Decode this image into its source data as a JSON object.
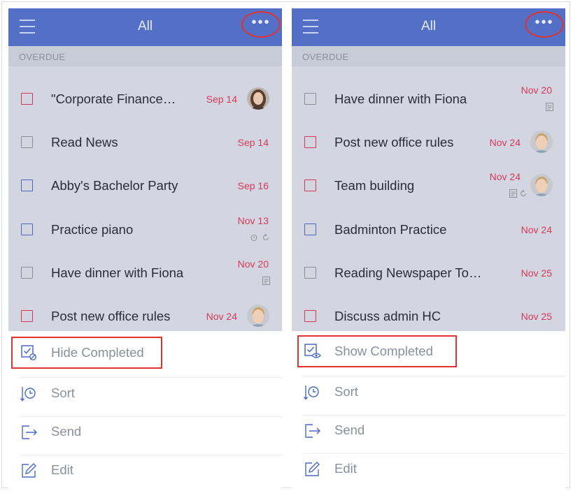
{
  "colors": {
    "header_bg": "#5470c6",
    "list_bg": "#d3d6e1",
    "date_red": "#d6385a",
    "checkbox_red": "#d6385a",
    "checkbox_blue": "#4a69c8",
    "checkbox_gray": "#8e8e93",
    "highlight_red": "#e0322f",
    "menu_text": "#8a8f9c"
  },
  "left": {
    "header": {
      "title": "All",
      "menu_icon": "hamburger-icon",
      "more": "•••"
    },
    "section": "OVERDUE",
    "tasks": [
      {
        "title": "\"Corporate Finance…",
        "date": "Sep 14",
        "checkbox": "red",
        "avatar": "female"
      },
      {
        "title": "Read News",
        "date": "Sep 14",
        "checkbox": "gray"
      },
      {
        "title": "Abby's Bachelor Party",
        "date": "Sep 16",
        "checkbox": "blue"
      },
      {
        "title": "Practice piano",
        "date": "Nov 13",
        "checkbox": "blue",
        "sub_icons": [
          "alarm-icon",
          "repeat-icon"
        ]
      },
      {
        "title": "Have dinner with Fiona",
        "date": "Nov 20",
        "checkbox": "gray",
        "sub_icons": [
          "note-icon"
        ]
      },
      {
        "title": "Post new office rules",
        "date": "Nov 24",
        "checkbox": "red",
        "avatar": "male"
      }
    ],
    "menu": [
      {
        "label": "Hide Completed",
        "icon": "hide-completed-icon"
      },
      {
        "label": "Sort",
        "icon": "sort-icon"
      },
      {
        "label": "Send",
        "icon": "send-icon"
      },
      {
        "label": "Edit",
        "icon": "edit-icon"
      }
    ]
  },
  "right": {
    "header": {
      "title": "All",
      "menu_icon": "hamburger-icon",
      "more": "•••"
    },
    "section": "OVERDUE",
    "tasks": [
      {
        "title": "Have dinner with Fiona",
        "date": "Nov 20",
        "checkbox": "gray",
        "sub_icons": [
          "note-icon"
        ]
      },
      {
        "title": "Post new office rules",
        "date": "Nov 24",
        "checkbox": "red",
        "avatar": "male"
      },
      {
        "title": "Team building",
        "date": "Nov 24",
        "checkbox": "red",
        "avatar": "male",
        "sub_icons": [
          "note-icon",
          "repeat-icon"
        ]
      },
      {
        "title": "Badminton Practice",
        "date": "Nov 24",
        "checkbox": "blue"
      },
      {
        "title": "Reading Newspaper To…",
        "date": "Nov 25",
        "checkbox": "gray"
      },
      {
        "title": "Discuss admin HC",
        "date": "Nov 25",
        "checkbox": "red"
      }
    ],
    "menu": [
      {
        "label": "Show Completed",
        "icon": "show-completed-icon"
      },
      {
        "label": "Sort",
        "icon": "sort-icon"
      },
      {
        "label": "Send",
        "icon": "send-icon"
      },
      {
        "label": "Edit",
        "icon": "edit-icon"
      }
    ]
  }
}
